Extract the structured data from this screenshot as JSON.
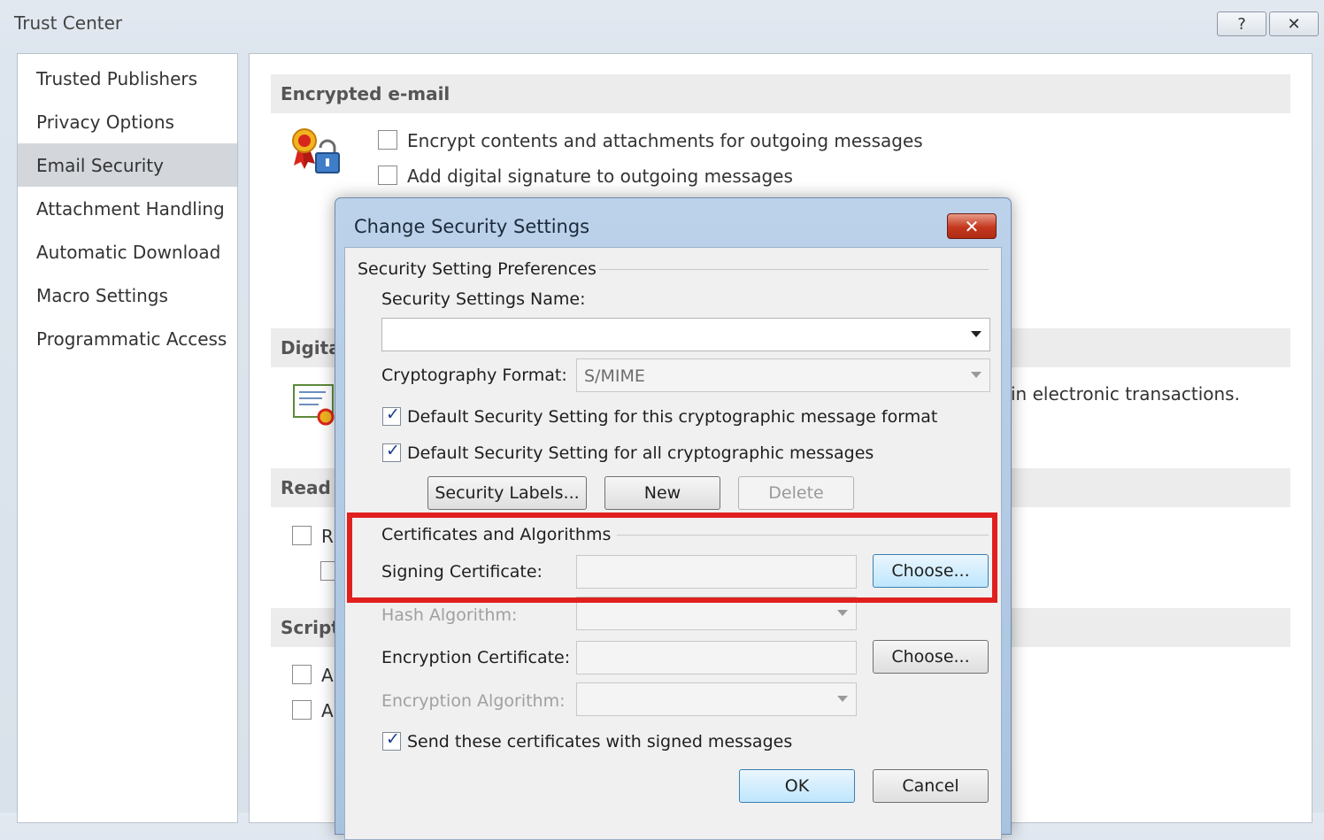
{
  "window": {
    "title": "Trust Center",
    "help_label": "?",
    "close_label": "✕"
  },
  "sidebar": {
    "items": [
      {
        "label": "Trusted Publishers"
      },
      {
        "label": "Privacy Options"
      },
      {
        "label": "Email Security",
        "active": true
      },
      {
        "label": "Attachment Handling"
      },
      {
        "label": "Automatic Download"
      },
      {
        "label": "Macro Settings"
      },
      {
        "label": "Programmatic Access"
      }
    ]
  },
  "main": {
    "encrypted_heading": "Encrypted e-mail",
    "encrypt_contents": "Encrypt contents and attachments for outgoing messages",
    "add_signature": "Add digital signature to outgoing messages",
    "digital_ids_heading_partial": "Digita",
    "digital_ids_text_partial": "in electronic transactions.",
    "read_heading_partial": "Read a",
    "read_check_partial": "R",
    "script_heading_partial": "Script",
    "script_check1_partial": "A",
    "script_check2_partial": "A"
  },
  "dialog": {
    "title": "Change Security Settings",
    "close_label": "✕",
    "prefs_group": "Security Setting Preferences",
    "settings_name_label": "Security Settings Name:",
    "settings_name_value": "",
    "crypto_format_label": "Cryptography Format:",
    "crypto_format_value": "S/MIME",
    "default_this_format": "Default Security Setting for this cryptographic message format",
    "default_all": "Default Security Setting for all cryptographic messages",
    "security_labels_button": "Security Labels...",
    "new_button": "New",
    "delete_button": "Delete",
    "certs_group": "Certificates and Algorithms",
    "signing_cert_label": "Signing Certificate:",
    "choose_signing_button": "Choose...",
    "hash_algo_label": "Hash Algorithm:",
    "encryption_cert_label": "Encryption Certificate:",
    "choose_encryption_button": "Choose...",
    "encryption_algo_label": "Encryption Algorithm:",
    "send_certs": "Send these certificates with signed messages",
    "ok_button": "OK",
    "cancel_button": "Cancel"
  },
  "colors": {
    "highlight": "#e0201e",
    "dialog_close": "#c4381e",
    "sidebar_active": "#d3d7dc"
  }
}
